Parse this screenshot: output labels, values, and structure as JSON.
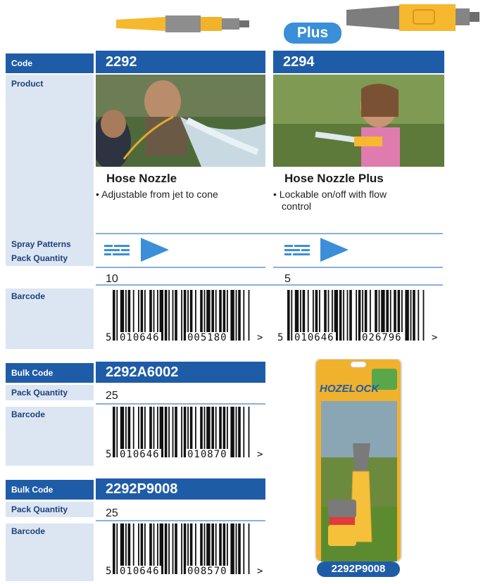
{
  "products": [
    {
      "code": "2292",
      "name": "Hose Nozzle",
      "bullet": "• Adjustable from jet to cone",
      "pack_quantity": "10",
      "barcode": {
        "lead": "5",
        "left": "010646",
        "right": "005180",
        "arrow": ">"
      }
    },
    {
      "code": "2294",
      "name": "Hose Nozzle Plus",
      "bullet_line1": "• Lockable on/off with flow",
      "bullet_line2": "control",
      "pack_quantity": "5",
      "barcode": {
        "lead": "5",
        "left": "010646",
        "right": "026796",
        "arrow": ">"
      },
      "badge": "Plus"
    }
  ],
  "labels": {
    "code": "Code",
    "product": "Product",
    "spray_patterns": "Spray Patterns",
    "pack_quantity": "Pack Quantity",
    "barcode": "Barcode",
    "bulk_code": "Bulk Code"
  },
  "bulk": [
    {
      "code": "2292A6002",
      "pack_quantity": "25",
      "barcode": {
        "lead": "5",
        "left": "010646",
        "right": "010870",
        "arrow": ">"
      }
    },
    {
      "code": "2292P9008",
      "pack_quantity": "25",
      "barcode": {
        "lead": "5",
        "left": "010646",
        "right": "008570",
        "arrow": ">"
      }
    }
  ],
  "package": {
    "brand": "HOZELOCK",
    "caption": "2292P9008"
  },
  "colors": {
    "accent": "#1f5ca8",
    "label_bg": "#dce6f3",
    "plus_badge": "#3a8fd8",
    "nozzle_yellow": "#f5b82e",
    "nozzle_grey": "#8a8a8a"
  },
  "icons": [
    "jet-spray-icon",
    "cone-spray-icon"
  ]
}
